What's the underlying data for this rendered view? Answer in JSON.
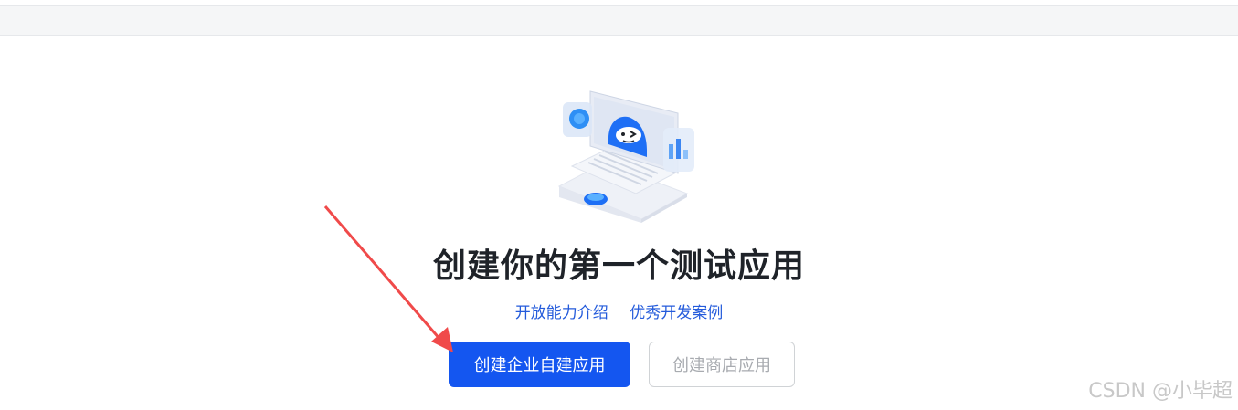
{
  "page": {
    "title": "创建你的第一个测试应用",
    "links": [
      "开放能力介绍",
      "优秀开发案例"
    ],
    "primary_button": "创建企业自建应用",
    "secondary_button": "创建商店应用"
  },
  "watermark": "CSDN @小毕超",
  "colors": {
    "primary": "#1456f0",
    "link": "#245bdb",
    "arrow": "#f04a4a"
  }
}
